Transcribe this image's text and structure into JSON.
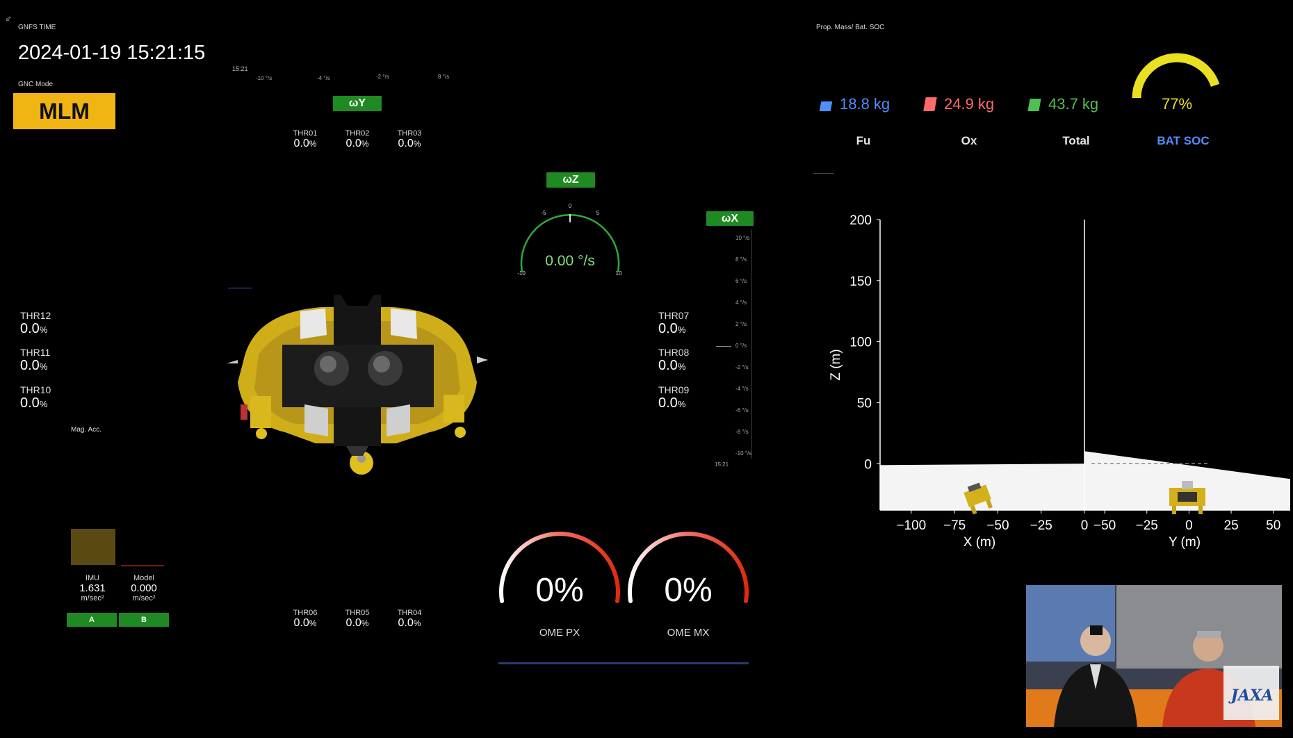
{
  "header": {
    "time_label": "GNFS TIME",
    "time_value": "2024-01-19 15:21:15",
    "gnc_label": "GNC Mode",
    "gnc_value": "MLM"
  },
  "omega_y": {
    "label": "ωY",
    "time": "15:21",
    "scale": [
      "-10 °/s",
      "-4 °/s",
      "-2 °/s",
      "8 °/s"
    ]
  },
  "omega_z": {
    "label": "ωZ",
    "value": "0.00 °/s",
    "ticks": [
      "-5",
      "0",
      "5",
      "-10",
      "10"
    ]
  },
  "omega_x": {
    "label": "ωX",
    "scale": [
      "10 °/s",
      "8 °/s",
      "6 °/s",
      "4 °/s",
      "2 °/s",
      "0 °/s",
      "-2 °/s",
      "-4 °/s",
      "-6 °/s",
      "-8 °/s",
      "-10 °/s"
    ],
    "time": "15:21"
  },
  "thrusters_top": [
    {
      "label": "THR01",
      "value": "0.0",
      "unit": "%"
    },
    {
      "label": "THR02",
      "value": "0.0",
      "unit": "%"
    },
    {
      "label": "THR03",
      "value": "0.0",
      "unit": "%"
    }
  ],
  "thrusters_bottom": [
    {
      "label": "THR06",
      "value": "0.0",
      "unit": "%"
    },
    {
      "label": "THR05",
      "value": "0.0",
      "unit": "%"
    },
    {
      "label": "THR04",
      "value": "0.0",
      "unit": "%"
    }
  ],
  "thrusters_left": [
    {
      "label": "THR12",
      "value": "0.0",
      "unit": "%"
    },
    {
      "label": "THR11",
      "value": "0.0",
      "unit": "%"
    },
    {
      "label": "THR10",
      "value": "0.0",
      "unit": "%"
    }
  ],
  "thrusters_right": [
    {
      "label": "THR07",
      "value": "0.0",
      "unit": "%"
    },
    {
      "label": "THR08",
      "value": "0.0",
      "unit": "%"
    },
    {
      "label": "THR09",
      "value": "0.0",
      "unit": "%"
    }
  ],
  "mag_acc": {
    "label": "Mag. Acc.",
    "imu_label": "IMU",
    "imu_value": "1.631",
    "imu_unit": "m/sec²",
    "model_label": "Model",
    "model_value": "0.000",
    "model_unit": "m/sec²",
    "btn_a": "A",
    "btn_b": "B"
  },
  "ome": [
    {
      "label": "OME PX",
      "value": "0%"
    },
    {
      "label": "OME MX",
      "value": "0%"
    }
  ],
  "prop_mass": {
    "title": "Prop. Mass/ Bat. SOC",
    "fu_value": "18.8 kg",
    "fu_label": "Fu",
    "fu_color": "#4f8fff",
    "ox_value": "24.9 kg",
    "ox_label": "Ox",
    "ox_color": "#ff6b6b",
    "total_value": "43.7 kg",
    "total_label": "Total",
    "total_color": "#4fbf4f",
    "soc_value": "77%",
    "soc_label": "BAT SOC",
    "soc_color": "#e8e020",
    "soc_label_color": "#4f8fff",
    "soc_fraction": 0.77
  },
  "chart_data": {
    "type": "scatter",
    "ylabel": "Z (m)",
    "y_ticks": [
      "200",
      "150",
      "100",
      "50",
      "0"
    ],
    "ylim": [
      -38,
      200
    ],
    "panels": [
      {
        "xlabel": "X (m)",
        "x_ticks": [
          "−100",
          "−75",
          "−50",
          "−25",
          "0"
        ],
        "xlim": [
          -118,
          0
        ]
      },
      {
        "xlabel": "Y (m)",
        "x_ticks": [
          "−50",
          "−25",
          "0",
          "25",
          "50"
        ],
        "xlim": [
          -62,
          60
        ]
      }
    ]
  },
  "video": {
    "logo": "JAXA"
  }
}
